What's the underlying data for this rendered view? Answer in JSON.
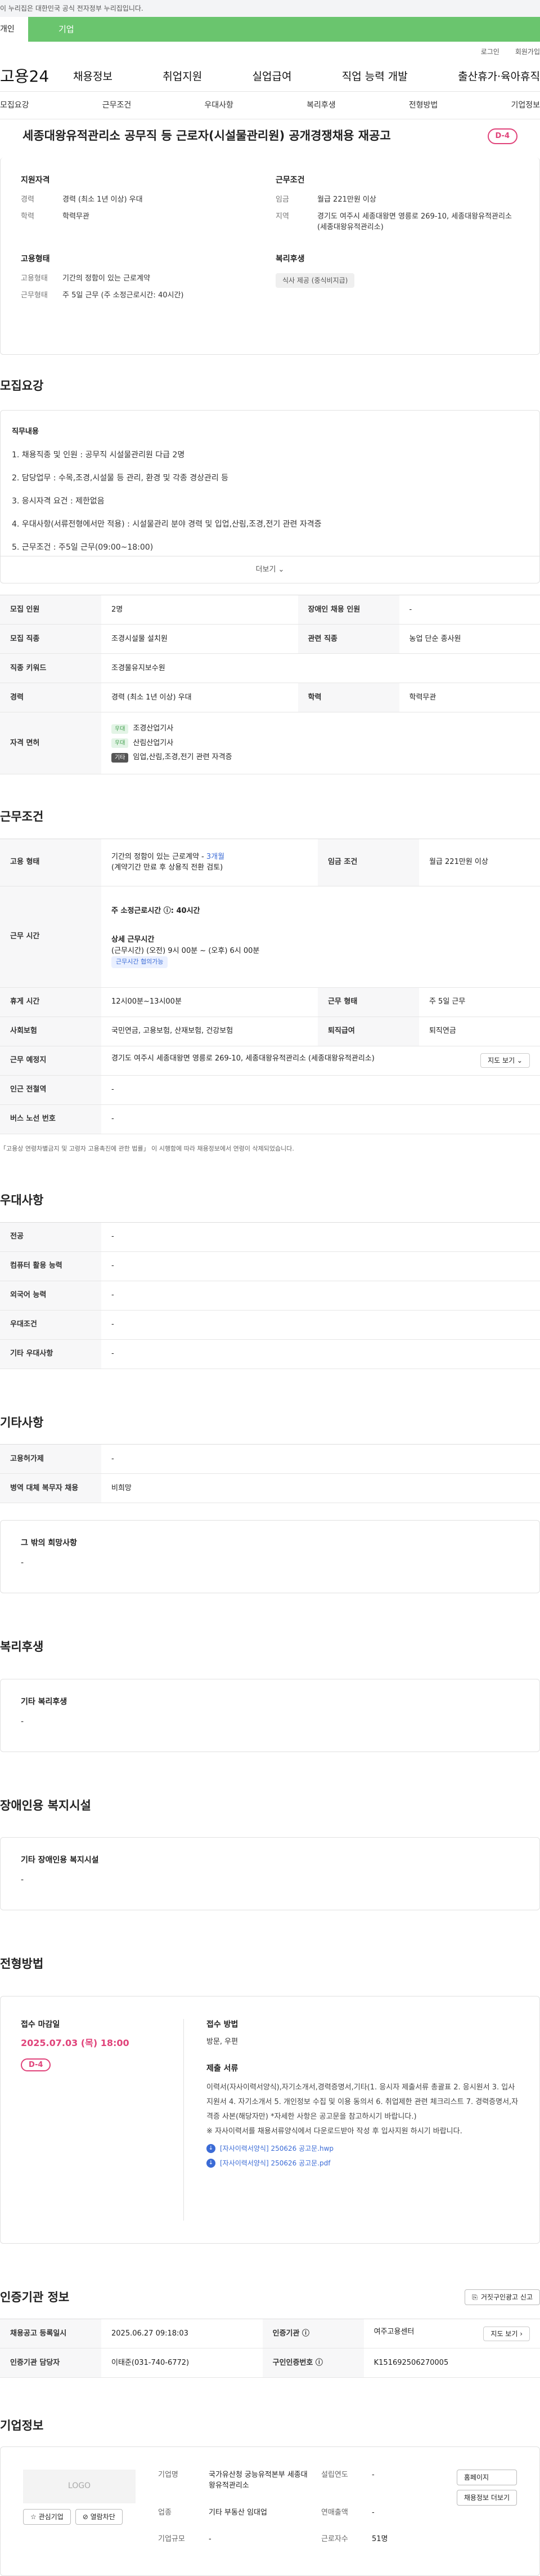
{
  "gov_banner": "이 누리집은 대한민국 공식 전자정부 누리집입니다.",
  "tabs": [
    "개인",
    "기업"
  ],
  "util": [
    "로그인",
    "회원가입"
  ],
  "gnb": {
    "logo": "고용24",
    "menu": [
      "채용정보",
      "취업지원",
      "실업급여",
      "직업 능력 개발",
      "출산휴가·육아휴직"
    ]
  },
  "subnav": [
    "모집요강",
    "근무조건",
    "우대사항",
    "복리후생",
    "전형방법",
    "기업정보"
  ],
  "job": {
    "title": "세종대왕유적관리소 공무직 등 근로자(시설물관리원) 공개경쟁채용 재공고",
    "dday": "D-4"
  },
  "summary": {
    "qual_title": "지원자격",
    "career_k": "경력",
    "career_v": "경력 (최소 1년 이상) 우대",
    "edu_k": "학력",
    "edu_v": "학력무관",
    "cond_title": "근무조건",
    "pay_k": "임금",
    "pay_v": "월급 221만원 이상",
    "loc_k": "지역",
    "loc_v": "경기도 여주시 세종대왕면 영릉로 269-10, 세종대왕유적관리소 (세종대왕유적관리소)",
    "type_title": "고용형태",
    "emp_k": "고용형태",
    "emp_v": "기간의 정함이 있는 근로계약",
    "form_k": "근무형태",
    "form_v": "주 5일 근무 (주 소정근로시간: 40시간)",
    "welfare_title": "복리후생",
    "welfare_tag": "식사 제공 (중식비지급)"
  },
  "recruit": {
    "section": "모집요강",
    "sub": "직무내용",
    "lines": [
      "1. 채용직종 및 인원 : 공무직 시설물관리원 다급 2명",
      "2. 담당업무 : 수목,조경,시설물 등 관리, 환경 및 각종 경상관리 등",
      "3. 응시자격 요건 : 제한없음",
      "4. 우대사항(서류전형에서만 적용) : 시설물관리 분야 경력 및 입업,산림,조경,전기 관련 자격증",
      "5. 근무조건 : 주5일 근무(09:00~18:00)"
    ],
    "more": "더보기 ⌄",
    "table": {
      "r1": [
        "모집 인원",
        "2명",
        "장애인 채용 인원",
        "-"
      ],
      "r2": [
        "모집 직종",
        "조경시설물 설치원",
        "관련 직종",
        "농업 단순 종사원"
      ],
      "r3": [
        "직종 키워드",
        "조경물유지보수원"
      ],
      "r4": [
        "경력",
        "경력 (최소 1년 이상) 우대",
        "학력",
        "학력무관"
      ],
      "license_k": "자격 면허",
      "licenses": [
        {
          "badge": "우대",
          "name": "조경산업기사"
        },
        {
          "badge": "우대",
          "name": "산림산업기사"
        },
        {
          "badge": "기타",
          "name": "임업,산림,조경,전기 관련 자격증"
        }
      ]
    }
  },
  "work": {
    "section": "근무조건",
    "emp_k": "고용 형태",
    "emp_v1": "기간의 정함이 있는 근로계약 - ",
    "emp_v1b": "3개월",
    "emp_v2": "(계약기간 만료 후 상용직 전환 검토)",
    "pay_k": "임금 조건",
    "pay_v": "월급 221만원 이상",
    "hours_k": "근무 시간",
    "hours_total": "주 소정근로시간 ⓘ: 40시간",
    "hours_detail_t": "상세 근무시간",
    "hours_detail": "(근무시간) (오전) 9시 00분 ~ (오후) 6시 00분",
    "hours_pill": "근무시간 협의가능",
    "break_k": "휴게 시간",
    "break_v": "12시00분~13시00분",
    "form_k": "근무 형태",
    "form_v": "주 5일 근무",
    "ins_k": "사회보험",
    "ins_v": "국민연금, 고용보험, 산재보험, 건강보험",
    "ret_k": "퇴직급여",
    "ret_v": "퇴직연금",
    "place_k": "근무 예정지",
    "place_v": "경기도 여주시 세종대왕면 영릉로 269-10, 세종대왕유적관리소 (세종대왕유적관리소)",
    "map_btn": "지도 보기 ⌄",
    "station_k": "인근 전철역",
    "station_v": "-",
    "bus_k": "버스 노선 번호",
    "bus_v": "-",
    "note": "「고용상 연령차별금지 및 고령자 고용촉진에 관한 법률」 이 시행함에 따라 채용정보에서 연령이 삭제되었습니다."
  },
  "pref": {
    "section": "우대사항",
    "rows": [
      [
        "전공",
        "-"
      ],
      [
        "컴퓨터 활용 능력",
        "-"
      ],
      [
        "외국어 능력",
        "-"
      ],
      [
        "우대조건",
        "-"
      ],
      [
        "기타 우대사항",
        "-"
      ]
    ]
  },
  "etc": {
    "section": "기타사항",
    "rows": [
      [
        "고용허가제",
        "-"
      ],
      [
        "병역 대체 복무자 채용",
        "비희망"
      ]
    ],
    "box_title": "그 밖의 희망사항",
    "box_v": "-"
  },
  "welfare": {
    "section": "복리후생",
    "box_title": "기타 복리후생",
    "box_v": "-"
  },
  "disabled": {
    "section": "장애인용 복지시설",
    "box_title": "기타 장애인용 복지시설",
    "box_v": "-"
  },
  "process": {
    "section": "전형방법",
    "deadline_t": "접수 마감일",
    "deadline": "2025.07.03 (목) 18:00",
    "dday": "D-4",
    "method_t": "접수 방법",
    "method_v": "방문, 우편",
    "docs_t": "제출 서류",
    "docs": "이력서(자사이력서양식),자기소개서,경력증명서,기타(1. 응시자 제출서류 총괄표 2. 응시원서 3. 입사지원서 4. 자기소개서 5. 개인정보 수집 및 이용 동의서 6. 취업제한 관련 체크리스트 7. 경력증명서,자격증 사본(해당자만) *자세한 사항은 공고문을 참고하시기 바랍니다.)",
    "docs2": "※ 자사이력서를 채용서류양식에서 다운로드받아 작성 후 입사지원 하시기 바랍니다.",
    "file1": "[자사이력서양식] 250626 공고문.hwp",
    "file2": "[자사이력서양식] 250626 공고문.pdf"
  },
  "agency": {
    "section": "인증기관 정보",
    "btn": "거짓구인광고 신고",
    "r1": [
      "채용공고 등록일시",
      "2025.06.27 09:18:03",
      "인증기관 ⓘ",
      "여주고용센터"
    ],
    "map_btn": "지도 보기 ›",
    "r2": [
      "인증기관 담당자",
      "이태준(031-740-6772)",
      "구인인증번호 ⓘ",
      "K151692506270005"
    ]
  },
  "company": {
    "section": "기업정보",
    "logo": "LOGO",
    "fav": "☆ 관심기업",
    "block": "⊘ 열람차단",
    "name_k": "기업명",
    "name_v": "국가유산청 궁능유적본부 세종대왕유적관리소",
    "est_k": "설립연도",
    "est_v": "-",
    "sales_k": "연매출액",
    "sales_v": "-",
    "emp_k": "근로자수",
    "emp_v": "51명",
    "ind_k": "업종",
    "ind_v": "기타 부동산 임대업",
    "size_k": "기업규모",
    "size_v": "-",
    "home_btn": "홈페이지",
    "list_btn": "채용정보 더보기"
  }
}
